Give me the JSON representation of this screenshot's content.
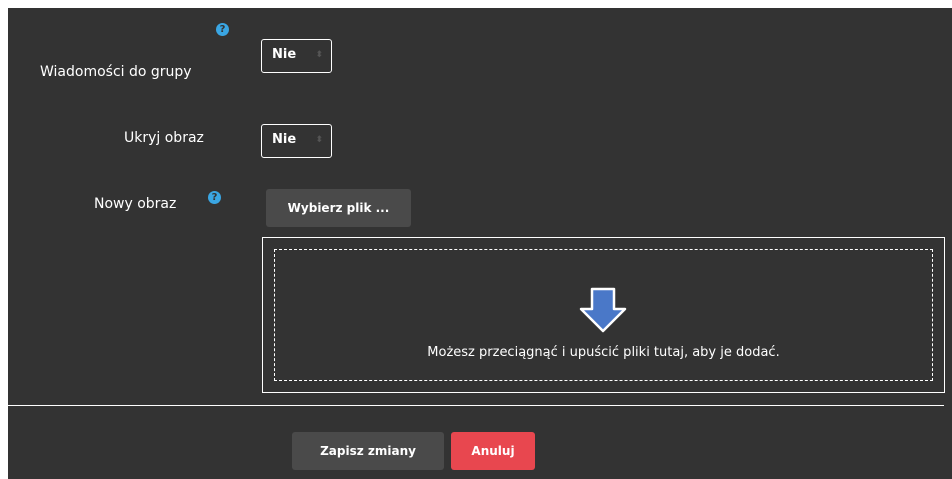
{
  "form": {
    "group_messages": {
      "label": "Wiadomości do grupy",
      "value": "Nie",
      "help": "?"
    },
    "hide_image": {
      "label": "Ukryj obraz",
      "value": "Nie"
    },
    "new_image": {
      "label": "Nowy obraz",
      "help": "?",
      "choose_file_label": "Wybierz plik ..."
    },
    "dropzone": {
      "text": "Możesz przeciągnąć i upuścić pliki tutaj, aby je dodać."
    }
  },
  "actions": {
    "save_label": "Zapisz zmiany",
    "cancel_label": "Anuluj"
  },
  "colors": {
    "panel": "#333333",
    "help": "#3aa6e3",
    "cancel": "#e8474f",
    "arrow": "#4a78c8"
  },
  "icons": [
    "help-icon",
    "arrow-down-icon",
    "select-caret-icon"
  ]
}
